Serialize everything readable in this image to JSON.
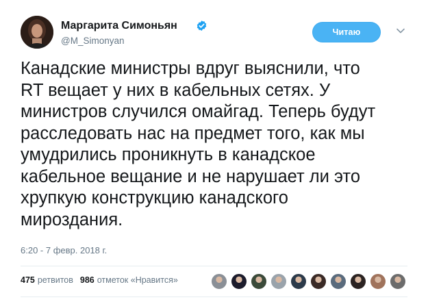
{
  "author": {
    "display_name": "Маргарита Симоньян",
    "handle": "@M_Simonyan",
    "verified": true,
    "avatar_icon": "profile-photo"
  },
  "header": {
    "follow_label": "Читаю",
    "menu_icon": "chevron-down-icon"
  },
  "tweet": {
    "text": "Канадские министры вдруг выяснили, что\nRT вещает у них в кабельных сетях. У\nминистров случился омайгад. Теперь будут\nрасследовать нас на предмет того, как мы\nумудрились проникнуть в канадское\nкабельное вещание и не нарушает ли это\nхрупкую конструкцию канадского\nмироздания.",
    "timestamp": "6:20 - 7 февр. 2018 г."
  },
  "stats": {
    "retweets_count": "475",
    "retweets_label": "ретвитов",
    "likes_count": "986",
    "likes_label": "отметок «Нравится»"
  },
  "liker_avatars": [
    {
      "color": "#8a8f96"
    },
    {
      "color": "#1c1c2c"
    },
    {
      "color": "#3b4a3a"
    },
    {
      "color": "#9aa3ab"
    },
    {
      "color": "#2c3a4a"
    },
    {
      "color": "#3a2a26"
    },
    {
      "color": "#5a6b7d"
    },
    {
      "color": "#2b2322"
    },
    {
      "color": "#a0735c"
    },
    {
      "color": "#6c6c6c"
    }
  ],
  "colors": {
    "accent": "#1da1f2",
    "follow_button": "#4ab3f4",
    "secondary_text": "#657786"
  }
}
